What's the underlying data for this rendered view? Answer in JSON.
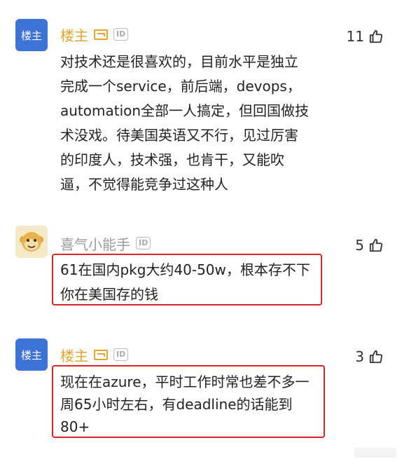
{
  "comments": [
    {
      "avatar_text": "楼主",
      "name": "楼主",
      "id_badge": "ID",
      "likes": "11",
      "lines": [
        "对技术还是很喜欢的，目前水平是独立",
        "完成一个service，前后端，devops，",
        "automation全部一人搞定，但回国做技",
        "术没戏。待美国英语又不行，见过厉害",
        "的印度人，技术强，也肯干，又能吹",
        "逼，不觉得能竞争过这种人"
      ]
    },
    {
      "avatar_icon": "monkey-avatar-icon",
      "name": "喜气小能手",
      "id_badge": "ID",
      "likes": "5",
      "lines": [
        "61在国内pkg大约40-50w，根本存不下",
        "你在美国存的钱"
      ]
    },
    {
      "avatar_text": "楼主",
      "name": "楼主",
      "id_badge": "ID",
      "likes": "3",
      "lines": [
        "现在在azure，平时工作时常也差不多一",
        "周65小时左右，有deadline的话能到",
        "80+"
      ]
    }
  ],
  "colors": {
    "owner_name": "#e5a52c",
    "highlight_border": "#d7262a",
    "owner_avatar": "#3d72d6"
  }
}
